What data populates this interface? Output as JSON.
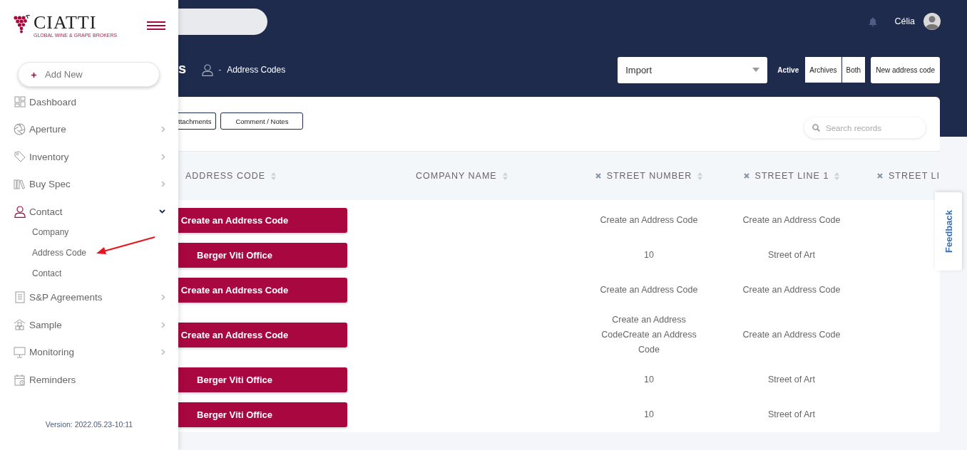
{
  "sidebar": {
    "logo": {
      "name": "CIATTI",
      "tagline": "GLOBAL WINE & GRAPE BROKERS"
    },
    "add_button": "Add New",
    "items": [
      {
        "label": "Dashboard"
      },
      {
        "label": "Aperture",
        "expanded": false
      },
      {
        "label": "Inventory",
        "expanded": false
      },
      {
        "label": "Buy Spec",
        "expanded": false
      },
      {
        "label": "Contact",
        "expanded": true,
        "children": [
          {
            "label": "Company"
          },
          {
            "label": "Address Code"
          },
          {
            "label": "Contact"
          }
        ]
      },
      {
        "label": "S&P Agreements",
        "expanded": false
      },
      {
        "label": "Sample",
        "expanded": false
      },
      {
        "label": "Monitoring",
        "expanded": false
      },
      {
        "label": "Reminders"
      }
    ],
    "version": "Version: 2022.05.23-10:11"
  },
  "header": {
    "user": "Célia"
  },
  "title_bar": {
    "title": "s",
    "separator": "-",
    "breadcrumb": "Address Codes",
    "import_select": {
      "value": "Import"
    },
    "filters": [
      {
        "label": "Active",
        "selected": true
      },
      {
        "label": "Archives",
        "selected": false
      },
      {
        "label": "Both",
        "selected": false
      }
    ],
    "new_button": "New address code"
  },
  "toolbar": {
    "buttons": [
      "ttachments",
      "Comment / Notes"
    ],
    "search": {
      "placeholder": "Search records"
    }
  },
  "table": {
    "columns": [
      {
        "label": "ADDRESS CODE",
        "removable": false
      },
      {
        "label": "COMPANY NAME",
        "removable": false
      },
      {
        "label": "STREET NUMBER",
        "removable": true
      },
      {
        "label": "STREET LINE 1",
        "removable": true
      },
      {
        "label": "STREET LI",
        "removable": true
      }
    ],
    "rows": [
      {
        "address_code": "Create an Address Code",
        "street_number": "Create an Address Code",
        "street_line_1": "Create an Address Code"
      },
      {
        "address_code": "Berger Viti Office",
        "street_number": "10",
        "street_line_1": "Street of Art"
      },
      {
        "address_code": "Create an Address Code",
        "street_number": "Create an Address Code",
        "street_line_1": "Create an Address Code"
      },
      {
        "address_code": "Create an Address Code",
        "street_number": "Create an Address CodeCreate an Address Code",
        "street_line_1": "Create an Address Code"
      },
      {
        "address_code": "Berger Viti Office",
        "street_number": "10",
        "street_line_1": "Street of Art"
      },
      {
        "address_code": "Berger Viti Office",
        "street_number": "10",
        "street_line_1": "Street of Art"
      }
    ]
  },
  "feedback": "Feedback"
}
